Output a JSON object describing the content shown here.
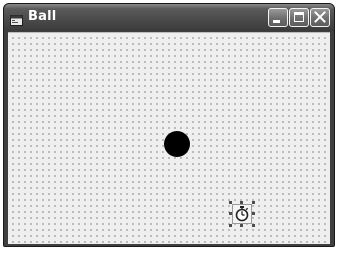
{
  "window": {
    "title": "Ball"
  },
  "icons": {
    "app": "form-window-icon",
    "minimize": "minimize-icon",
    "maximize": "maximize-icon",
    "close": "close-icon",
    "timer": "stopwatch-icon"
  },
  "colors": {
    "titlebar": "#4a4a4a",
    "title_text": "#ffffff",
    "form_background": "#efefef",
    "grid_dots": "#8c8c8c",
    "ball": "#000000"
  },
  "form": {
    "grid": "dotted",
    "controls": [
      "ball",
      "timer"
    ]
  }
}
